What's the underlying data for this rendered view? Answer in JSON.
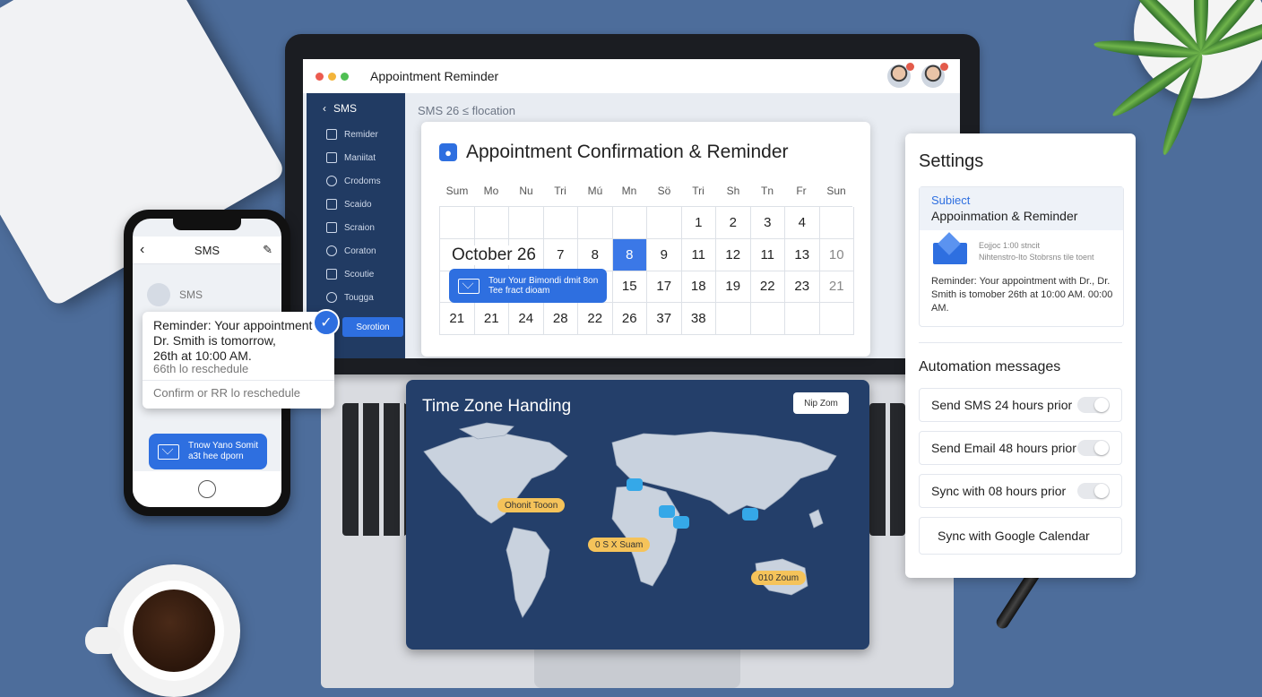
{
  "window": {
    "title": "Appointment Reminder"
  },
  "sidebar": {
    "back_label": "SMS",
    "items": [
      "Remider",
      "Maniitat",
      "Crodoms",
      "Scaido",
      "Scraion",
      "Coraton",
      "Scoutie",
      "Tougga"
    ],
    "active_label": "Sorotion"
  },
  "breadcrumb": "SMS 26 ≤ flocation",
  "calendar": {
    "title": "Appointment Confirmation & Reminder",
    "weekdays": [
      "Sum",
      "Mo",
      "Nu",
      "Tri",
      "Mú",
      "Mn",
      "Sö",
      "Tri",
      "Sh",
      "Tn",
      "Fr",
      "Sun"
    ],
    "month_label": "October 26",
    "rows": [
      [
        "",
        "",
        "",
        "",
        "",
        "",
        "",
        "1",
        "2",
        "3",
        "4"
      ],
      [
        "",
        "",
        "",
        "7",
        "8",
        "8",
        "9",
        "11",
        "12",
        "11",
        "13",
        "10"
      ],
      [
        "",
        "",
        "",
        "",
        "",
        "15",
        "17",
        "18",
        "19",
        "22",
        "23",
        "21"
      ],
      [
        "21",
        "21",
        "24",
        "28",
        "22",
        "26",
        "37",
        "38",
        "",
        "",
        ""
      ]
    ],
    "selected_day": "8",
    "event_text": "Tour Your Bimondi dmit 8on Tee fract dioam"
  },
  "map": {
    "title": "Time Zone Handing",
    "button_label": "Nip Zom",
    "tags": [
      "Ohonit Tooon",
      "0 S X Suam",
      "010 Zoum"
    ]
  },
  "phone": {
    "header_title": "SMS",
    "contact_label": "SMS",
    "message_lines": [
      "Reminder: Your appointment",
      "Dr. Smith is tomorrow,",
      "26th at 10:00 AM."
    ],
    "message_sub": "66th lo reschedule",
    "confirm_text": "Confirm  or  RR  lo reschedule",
    "bubble_line1": "Tnow Yano Somit",
    "bubble_line2": "a3t hee dporn"
  },
  "settings": {
    "title": "Settings",
    "subject_label": "Subiect",
    "subject_value": "Appoinmation & Reminder",
    "preview_line1": "Eojjoc 1:00 stncit",
    "preview_line2": "Nihtenstro-Ito Stobrsns tile toent",
    "reminder_text": "Reminder: Your appointment with Dr., Dr. Smith is tomober 26th at 10:00 AM. 00:00 AM.",
    "automation_title": "Automation messages",
    "options": [
      {
        "label": "Send SMS 24 hours prior",
        "toggle": true
      },
      {
        "label": "Send Email 48 hours prior",
        "toggle": true
      },
      {
        "label": "Sync with 08 hours prior",
        "toggle": true
      },
      {
        "label": "Sync with Google Calendar",
        "toggle": false
      }
    ]
  },
  "colors": {
    "accent": "#2e6fe0",
    "background": "#4d6d9b",
    "sidebar": "#213b63",
    "map": "#243f6a",
    "tag": "#f5c35a"
  }
}
